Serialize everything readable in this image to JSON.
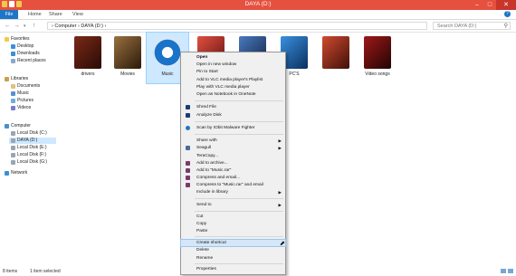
{
  "window": {
    "title": "DAYA (D:)"
  },
  "ribbon": {
    "tabs": [
      "File",
      "Home",
      "Share",
      "View"
    ]
  },
  "address": {
    "path": "›  Computer  ›  DAYA (D:)  ›",
    "search_placeholder": "Search DAYA (D:)"
  },
  "nav": {
    "favorites": "Favorites",
    "desktop": "Desktop",
    "downloads": "Downloads",
    "recent": "Recent places",
    "libraries": "Libraries",
    "documents": "Documents",
    "music": "Music",
    "pictures": "Pictures",
    "videos": "Videos",
    "computer": "Computer",
    "disk_c": "Local Disk (C:)",
    "daya_d": "DAYA (D:)",
    "disk_e": "Local Disk (E:)",
    "disk_f": "Local Disk (F:)",
    "disk_g": "Local Disk (G:)",
    "network": "Network"
  },
  "folders": [
    {
      "label": "drivers",
      "color": "#5a1e14"
    },
    {
      "label": "Movies",
      "color": "#6b4a2a"
    },
    {
      "label": "Music",
      "color": "#1a73c9"
    },
    {
      "label": "",
      "color": "#c0392b"
    },
    {
      "label": "",
      "color": "#2c5aa0"
    },
    {
      "label": "PC'S",
      "color": "#1e6fbf"
    },
    {
      "label": "",
      "color": "#b03a2e"
    },
    {
      "label": "Video songs",
      "color": "#8a1010"
    }
  ],
  "context_menu": {
    "open": "Open",
    "open_new_window": "Open in new window",
    "pin_start": "Pin to Start",
    "vlc_playlist": "Add to VLC media player's Playlist",
    "vlc_play": "Play with VLC media player",
    "onenote": "Open as Notebook in OneNote",
    "shred": "Shred File",
    "analyze": "Analyze Disk",
    "iobit": "Scan by IObit Malware Fighter",
    "share_with": "Share with",
    "seagull": "Seagull",
    "teracopy": "TeraCopy...",
    "add_archive": "Add to archive...",
    "add_music_rar": "Add to \"Music.rar\"",
    "compress_email": "Compress and email...",
    "compress_music_email": "Compress to \"Music.rar\" and email",
    "include_library": "Include in library",
    "send_to": "Send to",
    "cut": "Cut",
    "copy": "Copy",
    "paste": "Paste",
    "create_shortcut": "Create shortcut",
    "delete": "Delete",
    "rename": "Rename",
    "properties": "Properties"
  },
  "status": {
    "count": "8 items",
    "selected": "1 item selected"
  }
}
